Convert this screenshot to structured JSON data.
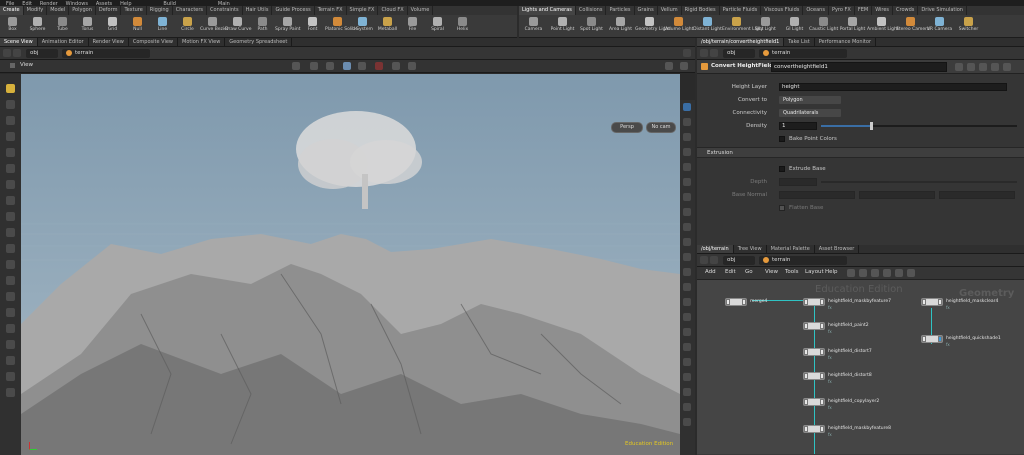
{
  "menubar": [
    "File",
    "Edit",
    "Render",
    "Windows",
    "Assets",
    "Help",
    "Build",
    "Main"
  ],
  "shelf_left_tabs": [
    "Create",
    "Modify",
    "Model",
    "Polygon",
    "Deform",
    "Texture",
    "Rigging",
    "Characters",
    "Constraints",
    "Hair Utils",
    "Guide Process",
    "Terrain FX",
    "Simple FX",
    "Cloud FX",
    "Volume"
  ],
  "shelf_left_tools": [
    "Box",
    "Sphere",
    "Tube",
    "Torus",
    "Grid",
    "Null",
    "Line",
    "Circle",
    "Curve Bezier",
    "Draw Curve",
    "Path",
    "Spray Paint",
    "Font",
    "Platonic Solids",
    "L-System",
    "Metaball",
    "File",
    "Spiral",
    "Helix"
  ],
  "shelf_right_tabs": [
    "Lights and Cameras",
    "Collisions",
    "Particles",
    "Grains",
    "Vellum",
    "Rigid Bodies",
    "Particle Fluids",
    "Viscous Fluids",
    "Oceans",
    "Pyro FX",
    "FEM",
    "Wires",
    "Crowds",
    "Drive Simulation"
  ],
  "shelf_right_tools": [
    "Camera",
    "Point Light",
    "Spot Light",
    "Area Light",
    "Geometry Light",
    "Volume Light",
    "Distant Light",
    "Environment Light",
    "Sky Light",
    "GI Light",
    "Caustic Light",
    "Portal Light",
    "Ambient Light",
    "Stereo Camera",
    "VR Camera",
    "Switcher"
  ],
  "viewport": {
    "tabs": [
      "Scene View",
      "Animation Editor",
      "Render View",
      "Composite View",
      "Motion FX View",
      "Geometry Spreadsheet"
    ],
    "path_obj": "obj",
    "path_node": "terrain",
    "title": "View",
    "persp": "Persp",
    "cam": "No cam",
    "watermark": "Education Edition"
  },
  "params": {
    "tabs": [
      "/obj/terrain/convertheightfield1",
      "Take List",
      "Performance Monitor"
    ],
    "path_obj": "obj",
    "path_node": "terrain",
    "node_type": "Convert HeightField",
    "node_name": "convertheightfield1",
    "height_layer_label": "Height Layer",
    "height_layer": "height",
    "convert_to_label": "Convert to",
    "convert_to": "Polygon",
    "connectivity_label": "Connectivity",
    "connectivity": "Quadrilaterals",
    "density_label": "Density",
    "density": "1",
    "density_fraction": 0.25,
    "bake_label": "Bake Point Colors",
    "extrusion_label": "Extrusion",
    "extrude_label": "Extrude Base",
    "depth_label": "Depth",
    "base_normal_label": "Base Normal",
    "flatten_label": "Flatten Base"
  },
  "network": {
    "tabs": [
      "/obj/terrain",
      "Tree View",
      "Material Palette",
      "Asset Browser"
    ],
    "path_obj": "obj",
    "path_node": "terrain",
    "menu": [
      "Add",
      "Edit",
      "Go",
      "View",
      "Tools",
      "Layout",
      "Help"
    ],
    "watermark": "Education Edition",
    "context": "Geometry",
    "nodes": [
      {
        "name": "merge4",
        "sub": ""
      },
      {
        "name": "heightfield_maskbyfeature7",
        "sub": "fx"
      },
      {
        "name": "heightfield_maskclear4",
        "sub": "fx"
      },
      {
        "name": "heightfield_paint2",
        "sub": "fx"
      },
      {
        "name": "heightfield_quickshade1",
        "sub": "fx"
      },
      {
        "name": "heightfield_distort7",
        "sub": "fx"
      },
      {
        "name": "heightfield_distort8",
        "sub": "fx"
      },
      {
        "name": "heightfield_copylayer2",
        "sub": "fx"
      },
      {
        "name": "heightfield_maskbyfeature8",
        "sub": "fx"
      }
    ]
  },
  "colors": {
    "accent": "#e69a3c",
    "wire": "#2fc3c3",
    "sky": "#8fa7b8"
  }
}
